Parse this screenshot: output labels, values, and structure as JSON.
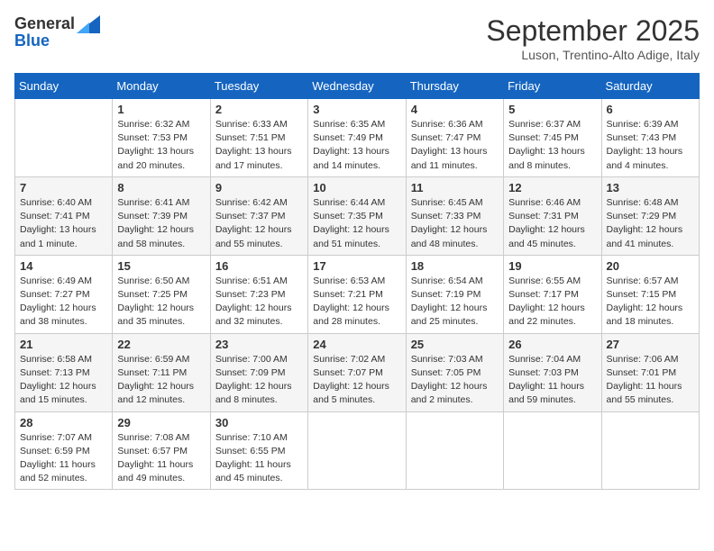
{
  "header": {
    "logo_line1": "General",
    "logo_line2": "Blue",
    "month": "September 2025",
    "location": "Luson, Trentino-Alto Adige, Italy"
  },
  "days_of_week": [
    "Sunday",
    "Monday",
    "Tuesday",
    "Wednesday",
    "Thursday",
    "Friday",
    "Saturday"
  ],
  "weeks": [
    [
      {
        "day": "",
        "info": ""
      },
      {
        "day": "1",
        "info": "Sunrise: 6:32 AM\nSunset: 7:53 PM\nDaylight: 13 hours and 20 minutes."
      },
      {
        "day": "2",
        "info": "Sunrise: 6:33 AM\nSunset: 7:51 PM\nDaylight: 13 hours and 17 minutes."
      },
      {
        "day": "3",
        "info": "Sunrise: 6:35 AM\nSunset: 7:49 PM\nDaylight: 13 hours and 14 minutes."
      },
      {
        "day": "4",
        "info": "Sunrise: 6:36 AM\nSunset: 7:47 PM\nDaylight: 13 hours and 11 minutes."
      },
      {
        "day": "5",
        "info": "Sunrise: 6:37 AM\nSunset: 7:45 PM\nDaylight: 13 hours and 8 minutes."
      },
      {
        "day": "6",
        "info": "Sunrise: 6:39 AM\nSunset: 7:43 PM\nDaylight: 13 hours and 4 minutes."
      }
    ],
    [
      {
        "day": "7",
        "info": "Sunrise: 6:40 AM\nSunset: 7:41 PM\nDaylight: 13 hours and 1 minute."
      },
      {
        "day": "8",
        "info": "Sunrise: 6:41 AM\nSunset: 7:39 PM\nDaylight: 12 hours and 58 minutes."
      },
      {
        "day": "9",
        "info": "Sunrise: 6:42 AM\nSunset: 7:37 PM\nDaylight: 12 hours and 55 minutes."
      },
      {
        "day": "10",
        "info": "Sunrise: 6:44 AM\nSunset: 7:35 PM\nDaylight: 12 hours and 51 minutes."
      },
      {
        "day": "11",
        "info": "Sunrise: 6:45 AM\nSunset: 7:33 PM\nDaylight: 12 hours and 48 minutes."
      },
      {
        "day": "12",
        "info": "Sunrise: 6:46 AM\nSunset: 7:31 PM\nDaylight: 12 hours and 45 minutes."
      },
      {
        "day": "13",
        "info": "Sunrise: 6:48 AM\nSunset: 7:29 PM\nDaylight: 12 hours and 41 minutes."
      }
    ],
    [
      {
        "day": "14",
        "info": "Sunrise: 6:49 AM\nSunset: 7:27 PM\nDaylight: 12 hours and 38 minutes."
      },
      {
        "day": "15",
        "info": "Sunrise: 6:50 AM\nSunset: 7:25 PM\nDaylight: 12 hours and 35 minutes."
      },
      {
        "day": "16",
        "info": "Sunrise: 6:51 AM\nSunset: 7:23 PM\nDaylight: 12 hours and 32 minutes."
      },
      {
        "day": "17",
        "info": "Sunrise: 6:53 AM\nSunset: 7:21 PM\nDaylight: 12 hours and 28 minutes."
      },
      {
        "day": "18",
        "info": "Sunrise: 6:54 AM\nSunset: 7:19 PM\nDaylight: 12 hours and 25 minutes."
      },
      {
        "day": "19",
        "info": "Sunrise: 6:55 AM\nSunset: 7:17 PM\nDaylight: 12 hours and 22 minutes."
      },
      {
        "day": "20",
        "info": "Sunrise: 6:57 AM\nSunset: 7:15 PM\nDaylight: 12 hours and 18 minutes."
      }
    ],
    [
      {
        "day": "21",
        "info": "Sunrise: 6:58 AM\nSunset: 7:13 PM\nDaylight: 12 hours and 15 minutes."
      },
      {
        "day": "22",
        "info": "Sunrise: 6:59 AM\nSunset: 7:11 PM\nDaylight: 12 hours and 12 minutes."
      },
      {
        "day": "23",
        "info": "Sunrise: 7:00 AM\nSunset: 7:09 PM\nDaylight: 12 hours and 8 minutes."
      },
      {
        "day": "24",
        "info": "Sunrise: 7:02 AM\nSunset: 7:07 PM\nDaylight: 12 hours and 5 minutes."
      },
      {
        "day": "25",
        "info": "Sunrise: 7:03 AM\nSunset: 7:05 PM\nDaylight: 12 hours and 2 minutes."
      },
      {
        "day": "26",
        "info": "Sunrise: 7:04 AM\nSunset: 7:03 PM\nDaylight: 11 hours and 59 minutes."
      },
      {
        "day": "27",
        "info": "Sunrise: 7:06 AM\nSunset: 7:01 PM\nDaylight: 11 hours and 55 minutes."
      }
    ],
    [
      {
        "day": "28",
        "info": "Sunrise: 7:07 AM\nSunset: 6:59 PM\nDaylight: 11 hours and 52 minutes."
      },
      {
        "day": "29",
        "info": "Sunrise: 7:08 AM\nSunset: 6:57 PM\nDaylight: 11 hours and 49 minutes."
      },
      {
        "day": "30",
        "info": "Sunrise: 7:10 AM\nSunset: 6:55 PM\nDaylight: 11 hours and 45 minutes."
      },
      {
        "day": "",
        "info": ""
      },
      {
        "day": "",
        "info": ""
      },
      {
        "day": "",
        "info": ""
      },
      {
        "day": "",
        "info": ""
      }
    ]
  ]
}
